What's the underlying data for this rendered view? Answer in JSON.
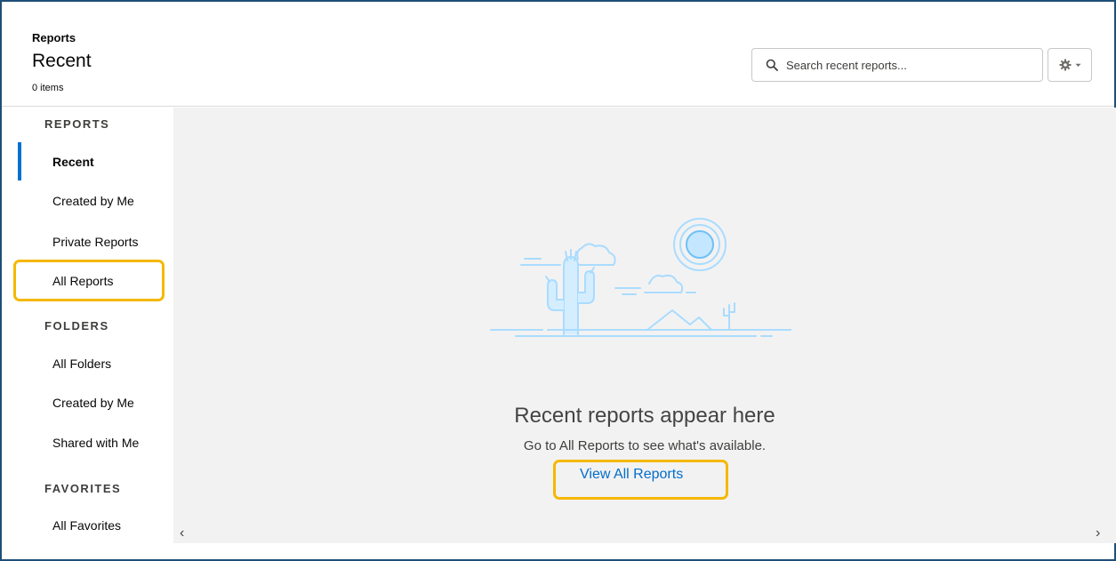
{
  "header": {
    "breadcrumb": "Reports",
    "title": "Recent",
    "item_count": "0 items",
    "search_placeholder": "Search recent reports..."
  },
  "sidebar": {
    "sections": [
      {
        "label": "REPORTS",
        "items": [
          "Recent",
          "Created by Me",
          "Private Reports",
          "All Reports"
        ]
      },
      {
        "label": "FOLDERS",
        "items": [
          "All Folders",
          "Created by Me",
          "Shared with Me"
        ]
      },
      {
        "label": "FAVORITES",
        "items": [
          "All Favorites"
        ]
      }
    ],
    "active_item": "Recent"
  },
  "main": {
    "empty_title": "Recent reports appear here",
    "empty_subtitle": "Go to All Reports to see what's available.",
    "view_link": "View All Reports"
  },
  "colors": {
    "accent": "#0070d2",
    "highlight": "#f5b800",
    "illustration": "#a9dcff",
    "link": "#006dcc"
  },
  "icons": [
    "search-icon",
    "gear-icon",
    "chevron-down-icon",
    "chevron-left-icon",
    "chevron-right-icon",
    "desert-illustration"
  ]
}
